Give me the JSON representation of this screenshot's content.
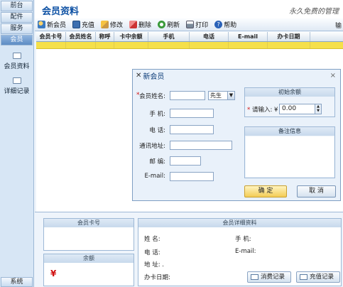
{
  "nav": {
    "items": [
      "前台",
      "配件",
      "服务",
      "会员"
    ],
    "links": [
      "会员资料",
      "详细记录"
    ],
    "bottom": "系统"
  },
  "header": {
    "title": "会员资料",
    "slogan": "永久免费的管理"
  },
  "toolbar": {
    "buttons": [
      "新会员",
      "充值",
      "修改",
      "删除",
      "刷新",
      "打印",
      "帮助"
    ],
    "overflow": "输"
  },
  "grid": {
    "columns": [
      "会员卡号",
      "会员姓名",
      "称呼",
      "卡中余额",
      "手机",
      "电话",
      "E-mail",
      "办卡日期"
    ]
  },
  "dialog": {
    "title": "新会员",
    "close": "×",
    "required_mark": "*",
    "name_label": "会员姓名:",
    "name_value": "",
    "gender_value": "先生",
    "mobile_label": "手   机:",
    "phone_label": "电   话:",
    "address_label": "通讯地址:",
    "zip_label": "邮   编:",
    "email_label": "E-mail:",
    "initial_group": "初始余额",
    "amount_label": "请输入:",
    "currency": "¥",
    "amount_value": "0.00",
    "notes_group": "备注信息",
    "ok": "确 定",
    "cancel": "取 消"
  },
  "details": {
    "card_panel": "会员卡号",
    "balance_panel": "余额",
    "balance_symbol": "¥",
    "detail_panel": "会员详细资料",
    "name": "姓   名:",
    "mobile": "手   机:",
    "phone": "电   话:",
    "email": "E-mail:",
    "address": "地   址: .",
    "date": "办卡日期:",
    "spend_btn": "消费记录",
    "recharge_btn": "充值记录"
  },
  "colors": {
    "accent": "#0b4fa3",
    "selected_row": "#f5e04a",
    "required": "#d01010"
  }
}
